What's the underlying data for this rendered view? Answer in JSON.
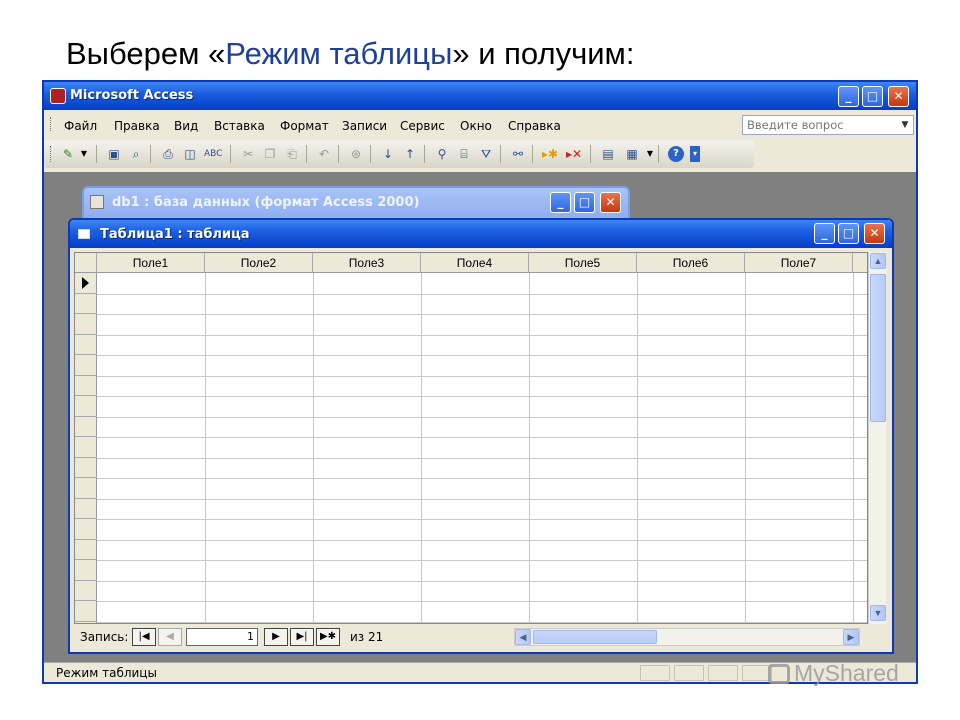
{
  "slide": {
    "title_before": "Выберем «",
    "title_highlight": "Режим таблицы",
    "title_after": "» и получим:"
  },
  "app": {
    "title": "Microsoft Access",
    "menu": [
      "Файл",
      "Правка",
      "Вид",
      "Вставка",
      "Формат",
      "Записи",
      "Сервис",
      "Окно",
      "Справка"
    ],
    "help_placeholder": "Введите вопрос"
  },
  "db_window": {
    "title": "db1 : база данных (формат Access 2000)"
  },
  "table_window": {
    "title": "Таблица1 : таблица",
    "columns": [
      "Поле1",
      "Поле2",
      "Поле3",
      "Поле4",
      "Поле5",
      "Поле6",
      "Поле7"
    ],
    "nav": {
      "label": "Запись:",
      "current": "1",
      "of_text": "из 21"
    }
  },
  "status": {
    "text": "Режим таблицы"
  },
  "watermark": {
    "text": "MyShared"
  }
}
